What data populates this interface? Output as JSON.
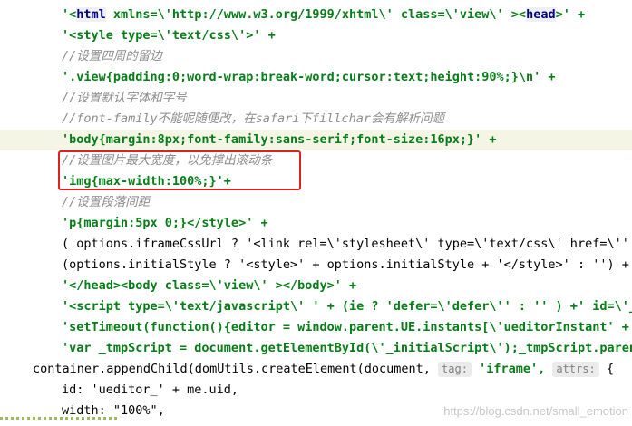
{
  "lines": [
    {
      "l1": "'<",
      "tag": "html",
      "attr1": " xmlns=\\'http://www.w3.org/1999/xhtml\\' class=\\'view\\' ><",
      "tag2": "head",
      "tail": ">' +"
    },
    {
      "text": "'<style type=\\'text/css\\'>' +"
    },
    {
      "comment": "//设置四周的留边"
    },
    {
      "text": "'.view{padding:0;word-wrap:break-word;cursor:text;height:90%;}\\n' +"
    },
    {
      "comment": "//设置默认字体和字号"
    },
    {
      "comment": "//font-family不能呢随便改，在safari下fillchar会有解析问题"
    },
    {
      "text": "'body{margin:8px;font-family:sans-serif;font-size:16px;}' +"
    },
    {
      "comment": "//设置图片最大宽度，以免撑出滚动条"
    },
    {
      "text": "'img{max-width:100%;}'+"
    },
    {
      "comment": "//设置段落间距"
    },
    {
      "text": "'p{margin:5px 0;}</style>' +"
    },
    {
      "text": "( options.iframeCssUrl ? '<link rel=\\'stylesheet\\' type=\\'text/css\\' href=\\'' +"
    },
    {
      "text": "(options.initialStyle ? '<style>' + options.initialStyle + '</style>' : '') +"
    },
    {
      "text": "'</head><body class=\\'view\\' ></body>' +"
    },
    {
      "text": "'<script type=\\'text/javascript\\' ' + (ie ? 'defer=\\'defer\\'' : '' ) +' id=\\'_i"
    },
    {
      "text": "'setTimeout(function(){editor = window.parent.UE.instants[\\'ueditorInstant' + m"
    },
    {
      "text": "'var _tmpScript = document.getElementById(\\'_initialScript\\');_tmpScript.parent"
    },
    {
      "pre": "container.appendChild(domUtils.createElement(document, ",
      "hint1": "tag:",
      "mid": " 'iframe', ",
      "hint2": "attrs:",
      "post": " {"
    },
    {
      "text": "id: 'ueditor_' + me.uid,"
    },
    {
      "text": "width: \"100%\","
    }
  ],
  "watermark": "https://blog.csdn.net/small_emotion"
}
